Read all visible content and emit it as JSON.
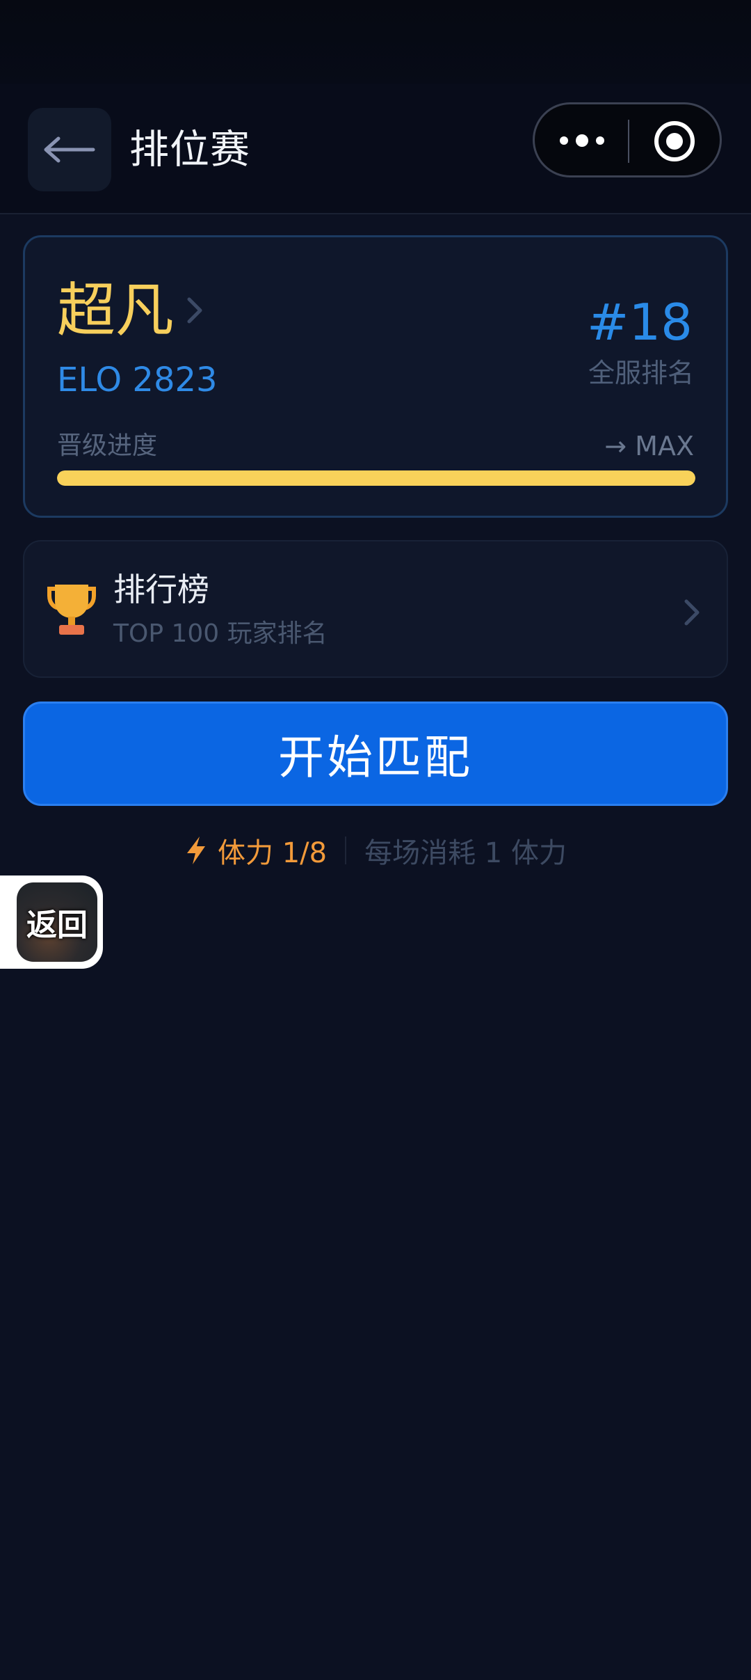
{
  "header": {
    "title": "排位赛",
    "back_icon": "arrow-left-icon",
    "more_icon": "more-dots-icon",
    "close_icon": "target-close-icon"
  },
  "rank_card": {
    "tier": "超凡",
    "elo": "ELO 2823",
    "rank": "#18",
    "rank_label": "全服排名",
    "progress_label": "晋级进度",
    "progress_target": "→ MAX",
    "progress_value": 1.0
  },
  "leaderboard": {
    "icon": "trophy-icon",
    "title": "排行榜",
    "subtitle": "TOP 100 玩家排名"
  },
  "match_button": {
    "label": "开始匹配"
  },
  "stamina": {
    "icon": "lightning-icon",
    "label": "体力 1/8",
    "cost": "每场消耗 1 体力"
  },
  "floating_back": {
    "label": "返回"
  },
  "colors": {
    "background": "#0c1122",
    "accent_blue": "#0b66e3",
    "gold": "#f7cf5c",
    "stamina_orange": "#f29a3a"
  }
}
